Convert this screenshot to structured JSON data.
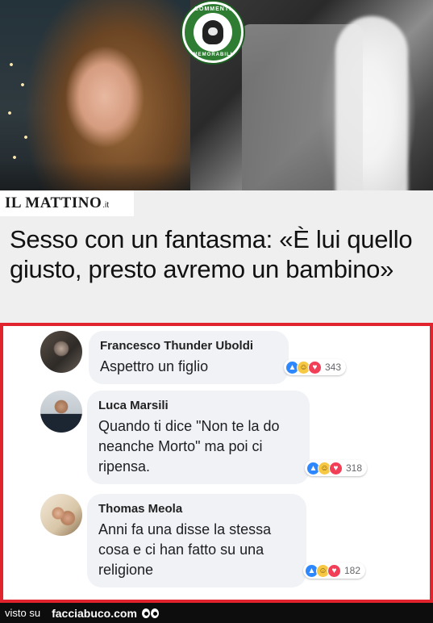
{
  "news": {
    "badge_top": "COMMENTI",
    "badge_bottom": "MEMORABILI",
    "logo": "IL MATTINO",
    "logo_suffix": ".it",
    "headline": "Sesso con un fantasma: «È lui quello giusto, presto avremo un bambino»"
  },
  "comments": [
    {
      "author": "Francesco Thunder Uboldi",
      "text": "Aspettro un figlio",
      "reactions": [
        "like-icon",
        "haha-icon",
        "love-icon"
      ],
      "count": "343"
    },
    {
      "author": "Luca Marsili",
      "text": "Quando ti dice \"Non te la do neanche Morto\" ma poi ci ripensa.",
      "reactions": [
        "like-icon",
        "haha-icon",
        "love-icon"
      ],
      "count": "318"
    },
    {
      "author": "Thomas Meola",
      "text": "Anni fa una disse la stessa cosa e ci han fatto su una religione",
      "reactions": [
        "like-icon",
        "haha-icon",
        "love-icon"
      ],
      "count": "182"
    }
  ],
  "footer": {
    "visto": "visto su",
    "site": "facciabuco.com"
  },
  "colors": {
    "frame": "#e0232d",
    "bubble": "#f0f2f5",
    "like": "#2d88ff",
    "haha": "#f7c844",
    "love": "#f33e58"
  }
}
